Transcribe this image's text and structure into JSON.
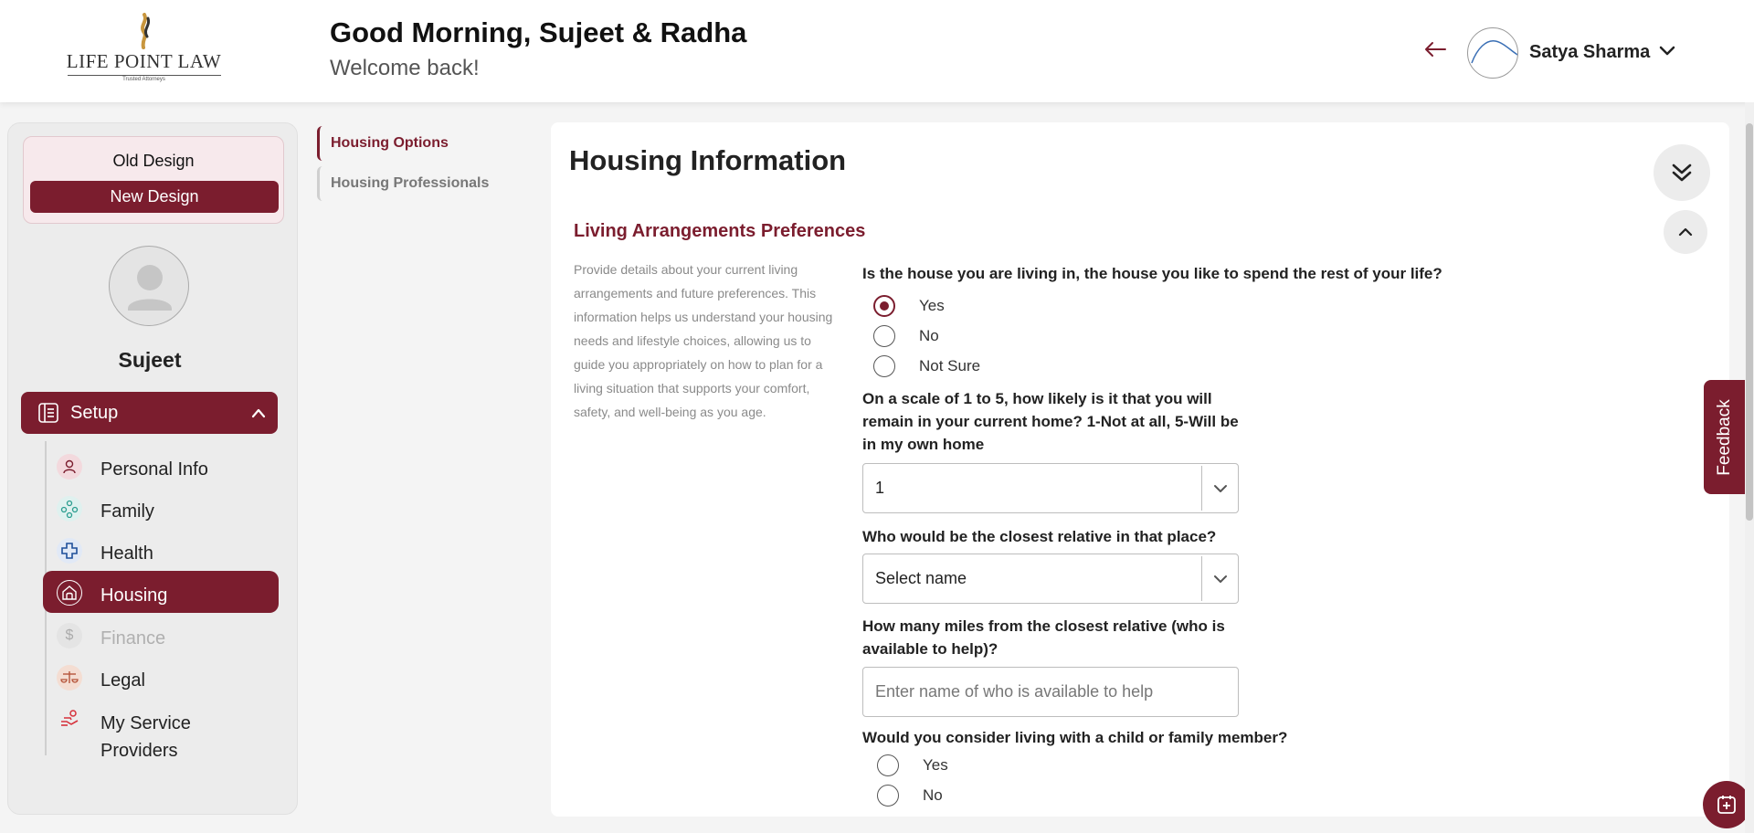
{
  "header": {
    "logo_text": "LIFE POINT LAW",
    "logo_tagline": "Trusted Attorneys",
    "greeting": "Good Morning, Sujeet & Radha",
    "subgreeting": "Welcome back!",
    "user_name": "Satya Sharma"
  },
  "sidebar": {
    "old_design": "Old Design",
    "new_design": "New Design",
    "profile_name": "Sujeet",
    "setup_label": "Setup",
    "items": [
      {
        "label": "Personal Info",
        "icon": "person-icon"
      },
      {
        "label": "Family",
        "icon": "family-icon"
      },
      {
        "label": "Health",
        "icon": "health-cross-icon"
      },
      {
        "label": "Housing",
        "icon": "home-icon",
        "active": true
      },
      {
        "label": "Finance",
        "icon": "dollar-icon",
        "disabled": true
      },
      {
        "label": "Legal",
        "icon": "scales-icon"
      },
      {
        "label": "My Service Providers",
        "icon": "service-provider-icon"
      }
    ]
  },
  "section_nav": {
    "items": [
      "Housing Options",
      "Housing Professionals"
    ],
    "active": "Housing Options"
  },
  "main": {
    "title": "Housing Information",
    "section_title": "Living Arrangements Preferences",
    "section_desc": "Provide details about your current living arrangements and future preferences. This information helps us understand your housing needs and lifestyle choices, allowing us to guide you appropriately on how to plan for a living situation that supports your comfort, safety, and well-being as you age.",
    "q1": {
      "text": "Is the house you are living in, the house you like to spend the rest of your life?",
      "options": [
        "Yes",
        "No",
        "Not Sure"
      ],
      "selected": "Yes"
    },
    "q2": {
      "text": "On a scale of 1 to 5, how likely is it that you will remain in your current home? 1-Not at all, 5-Will be in my own home",
      "value": "1"
    },
    "q3": {
      "text": "Who would be the closest relative in that place?",
      "value": "Select name"
    },
    "q4": {
      "text": "How many miles from the closest relative (who is available to help)?",
      "placeholder": "Enter name of who is available to help"
    },
    "q5": {
      "text": "Would you consider living with a child or family member?",
      "options": [
        "Yes",
        "No"
      ]
    }
  },
  "feedback_label": "Feedback",
  "colors": {
    "brand": "#7b1d2e",
    "brand_light": "#f7e9ec"
  }
}
